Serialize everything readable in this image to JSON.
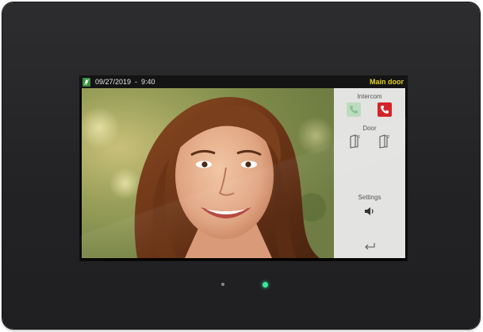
{
  "status_bar": {
    "datetime": "09/27/2019  -  9:40",
    "location": "Main door",
    "status_icon": "microphone-mute-icon"
  },
  "panel": {
    "intercom_label": "Intercom",
    "door_label": "Door",
    "settings_label": "Settings",
    "icons": {
      "accept": "phone-accept-icon",
      "hangup": "phone-hangup-icon",
      "door1": "door-lock-1-icon",
      "door2": "door-lock-2-icon",
      "volume": "speaker-volume-icon",
      "back": "back-arrow-icon"
    },
    "colors": {
      "accept_bg": "#bcdcbf",
      "hangup_bg": "#d4242a",
      "panel_bg": "#e3e3e1"
    }
  },
  "door_numbers": {
    "first": "1",
    "second": "2"
  },
  "colors": {
    "location_text": "#e6d21a",
    "status_led": "#3ee69a",
    "status_icon_bg": "#3a8f3f"
  }
}
